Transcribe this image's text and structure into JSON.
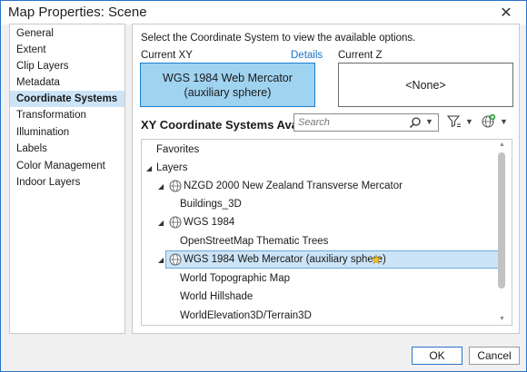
{
  "window": {
    "title": "Map Properties: Scene",
    "close_glyph": "✕"
  },
  "nav": {
    "items": [
      {
        "label": "General"
      },
      {
        "label": "Extent"
      },
      {
        "label": "Clip Layers"
      },
      {
        "label": "Metadata"
      },
      {
        "label": "Coordinate Systems",
        "selected": true
      },
      {
        "label": "Transformation"
      },
      {
        "label": "Illumination"
      },
      {
        "label": "Labels"
      },
      {
        "label": "Color Management"
      },
      {
        "label": "Indoor Layers"
      }
    ]
  },
  "panel": {
    "instruction": "Select the Coordinate System to view the available options.",
    "current_xy_label": "Current XY",
    "details_link": "Details",
    "current_z_label": "Current Z",
    "current_xy_line1": "WGS 1984 Web Mercator",
    "current_xy_line2": "(auxiliary sphere)",
    "current_z_value": "<None>",
    "available_title": "XY Coordinate Systems Available",
    "search_placeholder": "Search",
    "accent_color": "#9fd3f0",
    "selection_color": "#cce4f7"
  },
  "tree": {
    "favorites": "Favorites",
    "layers": "Layers",
    "items": [
      {
        "label": "NZGD 2000 New Zealand Transverse Mercator",
        "children": [
          "Buildings_3D"
        ]
      },
      {
        "label": "WGS 1984",
        "children": [
          "OpenStreetMap Thematic Trees"
        ]
      },
      {
        "label": "WGS 1984 Web Mercator (auxiliary sphere)",
        "selected": true,
        "children": [
          "World Topographic Map",
          "World Hillshade",
          "WorldElevation3D/Terrain3D"
        ]
      }
    ]
  },
  "buttons": {
    "ok": "OK",
    "cancel": "Cancel"
  },
  "icons": {
    "close": "close-icon",
    "search": "search-icon",
    "filter": "filter-icon",
    "add": "globe-add-icon",
    "globe": "globe-icon",
    "favorite": "star-icon"
  }
}
